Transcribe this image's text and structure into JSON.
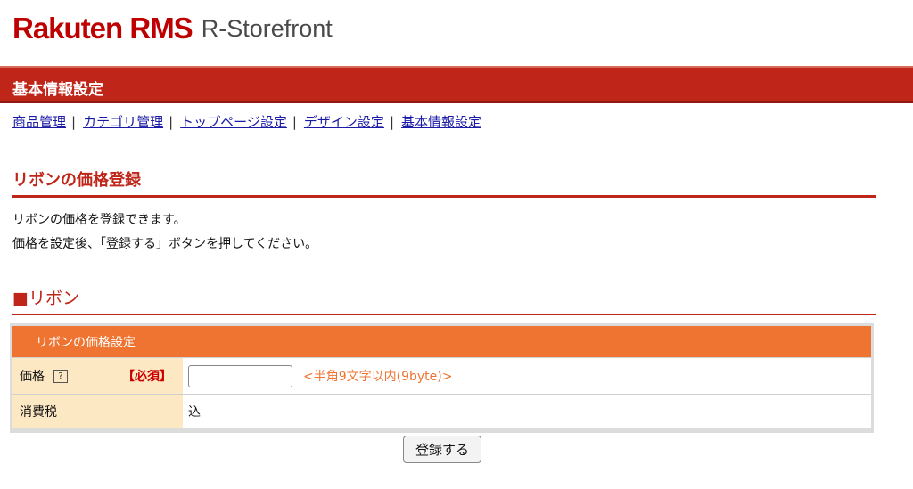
{
  "logo": {
    "brand": "Rakuten RMS",
    "product": "R-Storefront"
  },
  "title_bar": {
    "title": "基本情報設定"
  },
  "nav": {
    "items": [
      {
        "label": "商品管理"
      },
      {
        "label": "カテゴリ管理"
      },
      {
        "label": "トップページ設定"
      },
      {
        "label": "デザイン設定"
      },
      {
        "label": "基本情報設定"
      }
    ],
    "separator": "|"
  },
  "section": {
    "title": "リボンの価格登録"
  },
  "description": {
    "line1": "リボンの価格を登録できます。",
    "line2": "価格を設定後、「登録する」ボタンを押してください。"
  },
  "subsection": {
    "title": "■リボン"
  },
  "form": {
    "header": "リボンの価格設定",
    "price_label": "価格",
    "help_icon_glyph": "?",
    "required_label": "【必須】",
    "price_value": "",
    "price_hint": "<半角9文字以内(9byte)>",
    "tax_label": "消費税",
    "tax_value": "込"
  },
  "submit": {
    "label": "登録する"
  },
  "colors": {
    "brand_red": "#bf2619",
    "accent_orange": "#ef7431",
    "label_bg": "#fde8c4"
  }
}
